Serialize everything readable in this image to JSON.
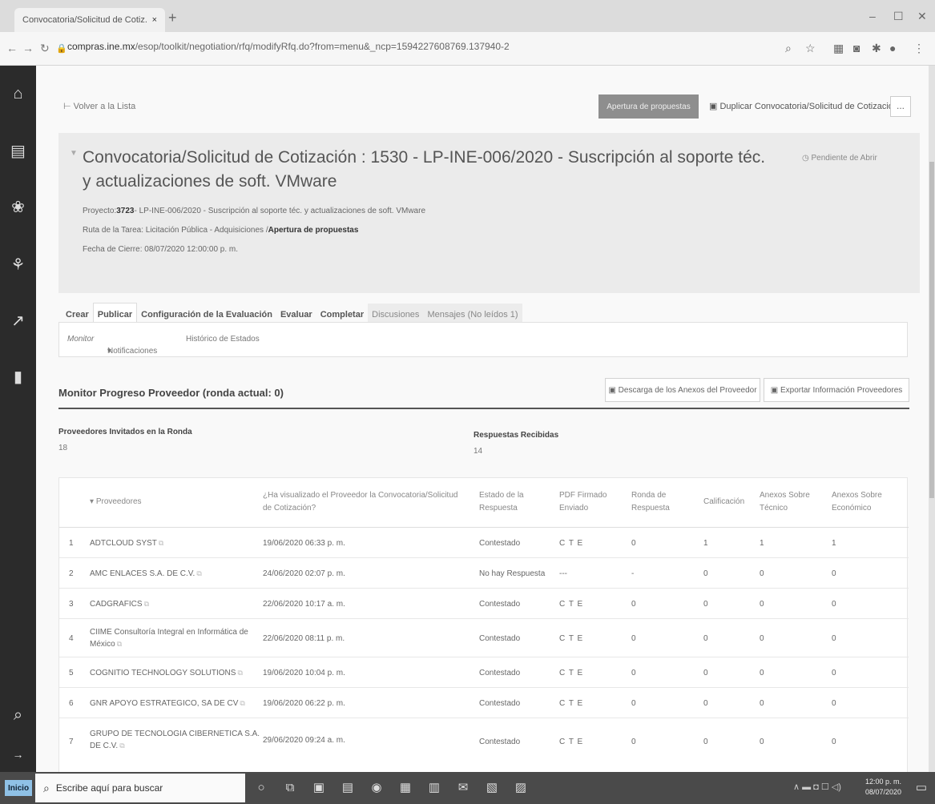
{
  "browser": {
    "tab_title": "Convocatoria/Solicitud de Cotiz...",
    "tab_close": "×",
    "new_tab": "+",
    "url_host": "compras.ine.mx",
    "url_path": "/esop/toolkit/negotiation/rfq/modifyRfq.do?from=menu&_ncp=1594227608769.137940-2"
  },
  "toolbar": {
    "back_label": "Volver a la Lista",
    "apertura_label": "Apertura de propuestas",
    "duplicar_label": "Duplicar Convocatoria/Solicitud de Cotización",
    "more_label": "..."
  },
  "header": {
    "title": "Convocatoria/Solicitud de Cotización : 1530 - LP-INE-006/2020 - Suscripción al soporte téc. y actualizaciones de soft. VMware",
    "status": "Pendiente de Abrir",
    "project_label": "Proyecto:",
    "project_code": "3723",
    "project_text": "- LP-INE-006/2020 - Suscripción al soporte téc. y actualizaciones de soft. VMware",
    "route_label": "Ruta de la Tarea: Licitación Pública - Adquisiciones /",
    "route_stage": "Apertura de propuestas",
    "close_date": "Fecha de Cierre: 08/07/2020 12:00:00 p. m."
  },
  "tabs": [
    "Crear",
    "Publicar",
    "Configuración de la Evaluación",
    "Evaluar",
    "Completar",
    "Discusiones",
    "Mensajes (No leídos 1)"
  ],
  "subtabs": {
    "monitor": "Monitor",
    "notificaciones": "Notificaciones",
    "historico": "Histórico de Estados"
  },
  "monitor": {
    "title": "Monitor Progreso Proveedor (ronda actual: 0)",
    "descarga_label": "Descarga de los Anexos del Proveedor",
    "exportar_label": "Exportar Información Proveedores",
    "invited_label": "Proveedores Invitados en la Ronda",
    "invited_value": "18",
    "responses_label": "Respuestas Recibidas",
    "responses_value": "14"
  },
  "table": {
    "headers": {
      "proveedores": "Proveedores",
      "visualizado": "¿Ha visualizado el Proveedor la Convocatoria/Solicitud de Cotización?",
      "estado": "Estado de la Respuesta",
      "pdf": "PDF Firmado Enviado",
      "ronda": "Ronda de Respuesta",
      "calificacion": "Calificación",
      "tecnico": "Anexos Sobre Técnico",
      "economico": "Anexos Sobre Económico"
    },
    "rows": [
      {
        "n": "1",
        "name": "ADTCLOUD SYST",
        "date": "19/06/2020 06:33 p. m.",
        "estado": "Contestado",
        "pdf": "C T E",
        "ronda": "0",
        "calif": "1",
        "tec": "1",
        "eco": "1"
      },
      {
        "n": "2",
        "name": "AMC ENLACES S.A. DE C.V.",
        "date": "24/06/2020 02:07 p. m.",
        "estado": "No hay Respuesta",
        "pdf": "---",
        "ronda": "-",
        "calif": "0",
        "tec": "0",
        "eco": "0"
      },
      {
        "n": "3",
        "name": "CADGRAFICS",
        "date": "22/06/2020 10:17 a. m.",
        "estado": "Contestado",
        "pdf": "C T E",
        "ronda": "0",
        "calif": "0",
        "tec": "0",
        "eco": "0"
      },
      {
        "n": "4",
        "name": "CIIME Consultoría Integral en Informática de",
        "name2": "México",
        "date": "22/06/2020 08:11 p. m.",
        "estado": "Contestado",
        "pdf": "C T E",
        "ronda": "0",
        "calif": "0",
        "tec": "0",
        "eco": "0"
      },
      {
        "n": "5",
        "name": "COGNITIO TECHNOLOGY SOLUTIONS",
        "date": "19/06/2020 10:04 p. m.",
        "estado": "Contestado",
        "pdf": "C T E",
        "ronda": "0",
        "calif": "0",
        "tec": "0",
        "eco": "0"
      },
      {
        "n": "6",
        "name": "GNR APOYO ESTRATEGICO, SA DE CV",
        "date": "19/06/2020 06:22 p. m.",
        "estado": "Contestado",
        "pdf": "C T E",
        "ronda": "0",
        "calif": "0",
        "tec": "0",
        "eco": "0"
      },
      {
        "n": "7",
        "name": "GRUPO DE TECNOLOGIA CIBERNETICA S.A.",
        "name2": "DE C.V.",
        "date": "29/06/2020 09:24 a. m.",
        "estado": "Contestado",
        "pdf": "C T E",
        "ronda": "0",
        "calif": "0",
        "tec": "0",
        "eco": "0"
      }
    ]
  },
  "taskbar": {
    "start_label": "Inicio",
    "search_placeholder": "Escribe aquí para buscar",
    "time": "12:00 p. m.",
    "date": "08/07/2020"
  },
  "icons": {
    "sidebar": [
      "home-icon",
      "calculator-icon",
      "handshake-icon",
      "org-chart-icon",
      "analytics-icon",
      "documents-icon",
      "search-icon",
      "expand-icon"
    ]
  },
  "colors": {
    "sidebar_bg": "#2b2b2b",
    "header_panel_bg": "#ebebeb",
    "apertura_button_bg": "#8e8e8e",
    "taskbar_bg": "#4a4a4a"
  }
}
